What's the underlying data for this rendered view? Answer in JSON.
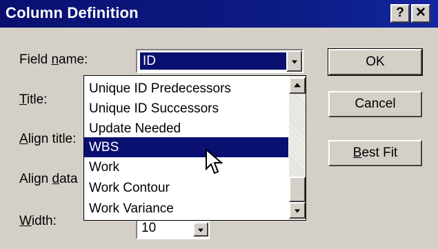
{
  "window": {
    "title": "Column Definition",
    "help_label": "?",
    "close_label": "✕"
  },
  "form": {
    "field_name_label_pre": "Field ",
    "field_name_label_ul": "n",
    "field_name_label_post": "ame:",
    "field_name_value": "ID",
    "title_label_ul": "T",
    "title_label_post": "itle:",
    "align_title_label_ul": "A",
    "align_title_label_post": "lign title:",
    "align_data_label_pre": "Align ",
    "align_data_label_ul": "d",
    "align_data_label_post": "ata",
    "width_label_ul": "W",
    "width_label_post": "idth:",
    "width_value": "10"
  },
  "buttons": {
    "ok": "OK",
    "cancel": "Cancel",
    "best_fit_ul": "B",
    "best_fit_post": "est Fit"
  },
  "dropdown": {
    "options": [
      "Unique ID Predecessors",
      "Unique ID Successors",
      "Update Needed",
      "WBS",
      "Work",
      "Work Contour",
      "Work Variance"
    ],
    "selected": "WBS"
  },
  "colors": {
    "face": "#d4d0c8",
    "title_bar": "#0a1070",
    "highlight": "#0a1070"
  },
  "icons": {
    "dropdown_arrow": "triangle-down",
    "scroll_up": "triangle-up",
    "scroll_down": "triangle-down",
    "cursor": "mouse-pointer"
  }
}
